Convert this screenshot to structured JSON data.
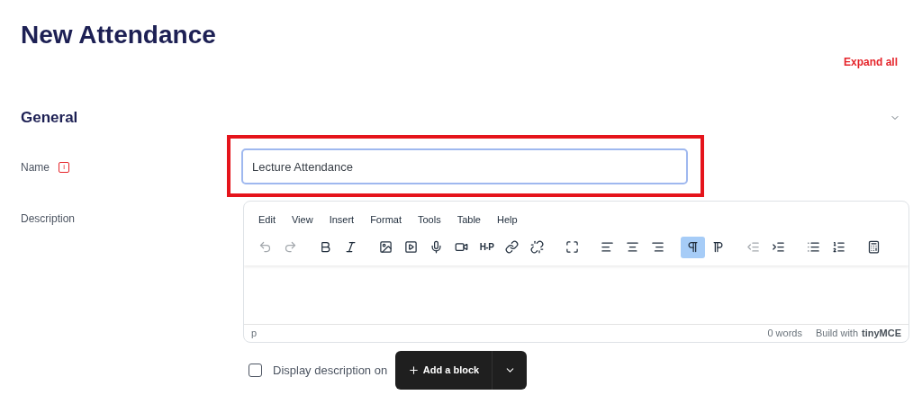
{
  "page_title": "New Attendance",
  "expand_all": "Expand all",
  "section": {
    "title": "General",
    "expanded": true
  },
  "name_field": {
    "label": "Name",
    "value": "Lecture Attendance",
    "info": "i"
  },
  "description": {
    "label": "Description",
    "menu": [
      "Edit",
      "View",
      "Insert",
      "Format",
      "Tools",
      "Table",
      "Help"
    ],
    "toolbar": [
      {
        "disabled": true,
        "selected": false
      },
      {
        "disabled": true,
        "selected": false
      },
      {
        "disabled": false,
        "selected": false
      },
      {
        "disabled": false,
        "selected": false
      },
      {
        "disabled": false,
        "selected": false
      },
      {
        "disabled": false,
        "selected": false
      },
      {
        "disabled": false,
        "selected": false
      },
      {
        "disabled": false,
        "selected": false
      },
      {
        "disabled": false,
        "selected": false,
        "label": "H-P"
      },
      {
        "disabled": false,
        "selected": false
      },
      {
        "disabled": false,
        "selected": false
      },
      {
        "disabled": false,
        "selected": false
      },
      {
        "disabled": false,
        "selected": false
      },
      {
        "disabled": false,
        "selected": false
      },
      {
        "disabled": false,
        "selected": false
      },
      {
        "disabled": false,
        "selected": true
      },
      {
        "disabled": false,
        "selected": false
      },
      {
        "disabled": true,
        "selected": false
      },
      {
        "disabled": false,
        "selected": false
      },
      {
        "disabled": false,
        "selected": false
      },
      {
        "disabled": false,
        "selected": false
      },
      {
        "disabled": false,
        "selected": false
      }
    ],
    "path": "p",
    "word_count": "0 words",
    "branding": "Build with",
    "brand": "tinyMCE"
  },
  "display_description": {
    "label": "Display description on",
    "checked": false
  },
  "add_block": {
    "label": "Add a block"
  }
}
